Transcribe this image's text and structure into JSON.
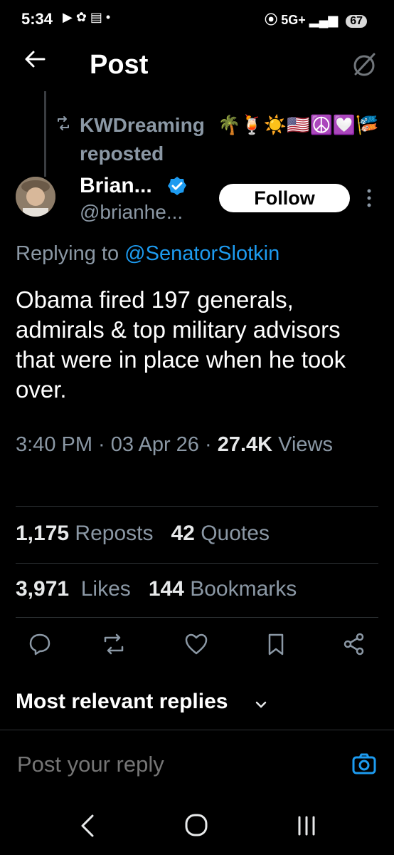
{
  "status_bar": {
    "time": "5:34",
    "icons_left": "▶ ✿ ▤ •",
    "network": "5G+",
    "battery": "67"
  },
  "header": {
    "title": "Post"
  },
  "repost": {
    "user": "KWDreaming",
    "emojis": "🌴🍹☀️🇺🇸☮️💟🎏",
    "label": "reposted"
  },
  "author": {
    "name": "Brian...",
    "handle": "@brianhe...",
    "follow_label": "Follow"
  },
  "post": {
    "replying_prefix": "Replying to ",
    "replying_to": "@SenatorSlotkin",
    "text": "Obama fired 197 generals, admirals & top military advisors that were in place when he took over.",
    "time": "3:40 PM · 03 Apr 26 · ",
    "views_count": "27.4K",
    "views_label": "Views"
  },
  "stats": {
    "reposts_count": "1,175",
    "reposts_label": "Reposts",
    "quotes_count": "42",
    "quotes_label": "Quotes",
    "likes_count": "3,971",
    "likes_label": "Likes",
    "bookmarks_count": "144",
    "bookmarks_label": "Bookmarks"
  },
  "replies": {
    "sort_label": "Most relevant replies",
    "placeholder": "Post your reply"
  },
  "colors": {
    "accent": "#1d9bf0",
    "muted": "#8b98a5",
    "background": "#000000"
  }
}
